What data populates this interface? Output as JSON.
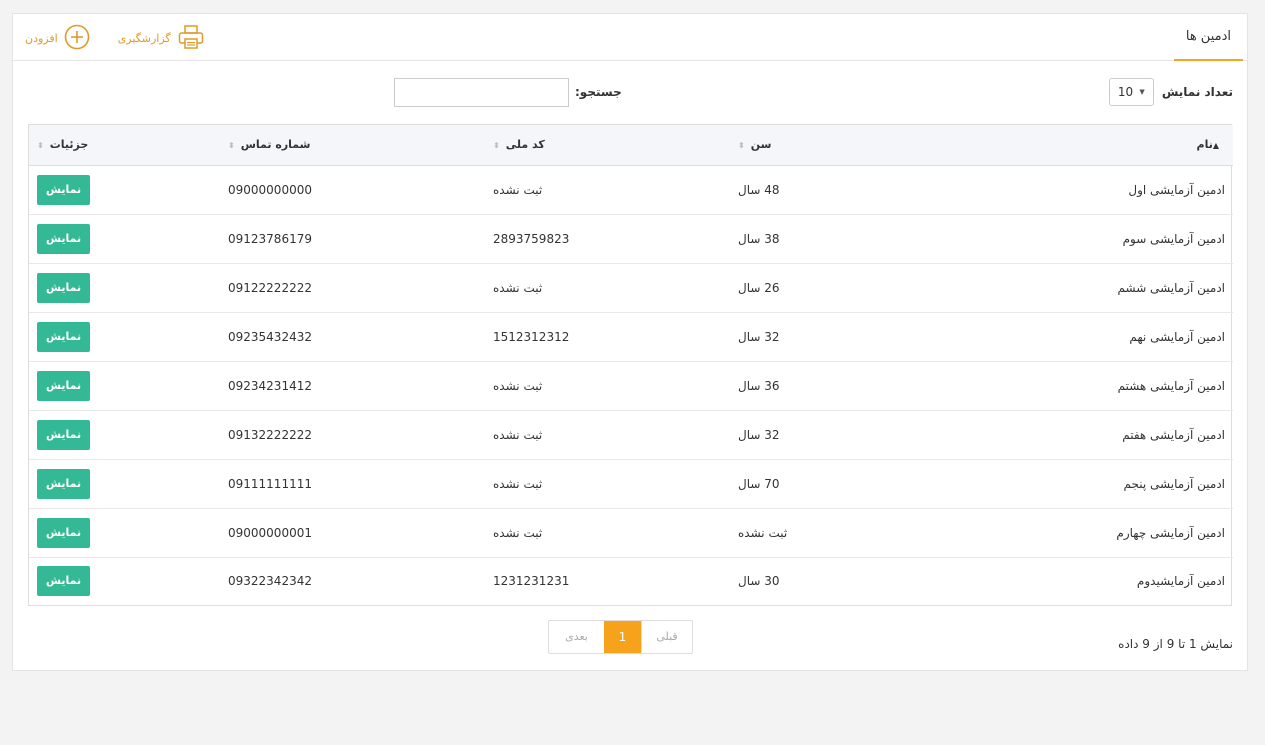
{
  "header": {
    "title": "ادمین ها",
    "add_label": "افزودن",
    "report_label": "گزارشگیری"
  },
  "controls": {
    "length_label": "تعداد نمایش",
    "length_value": "10",
    "search_label": "جستجو:",
    "search_value": ""
  },
  "table": {
    "columns": [
      "نام",
      "سن",
      "کد ملی",
      "شماره تماس",
      "جزئیات"
    ],
    "show_label": "نمایش",
    "rows": [
      {
        "name": "ادمین آزمایشی اول",
        "age": "48 سال",
        "national_code": "ثبت نشده",
        "phone": "09000000000"
      },
      {
        "name": "ادمین آزمایشی سوم",
        "age": "38 سال",
        "national_code": "2893759823",
        "phone": "09123786179"
      },
      {
        "name": "ادمین آزمایشی ششم",
        "age": "26 سال",
        "national_code": "ثبت نشده",
        "phone": "09122222222"
      },
      {
        "name": "ادمین آزمایشی نهم",
        "age": "32 سال",
        "national_code": "1512312312",
        "phone": "09235432432"
      },
      {
        "name": "ادمین آزمایشی هشتم",
        "age": "36 سال",
        "national_code": "ثبت نشده",
        "phone": "09234231412"
      },
      {
        "name": "ادمین آزمایشی هفتم",
        "age": "32 سال",
        "national_code": "ثبت نشده",
        "phone": "09132222222"
      },
      {
        "name": "ادمین آزمایشی پنجم",
        "age": "70 سال",
        "national_code": "ثبت نشده",
        "phone": "09111111111"
      },
      {
        "name": "ادمین آزمایشی چهارم",
        "age": "ثبت نشده",
        "national_code": "ثبت نشده",
        "phone": "09000000001"
      },
      {
        "name": "ادمین آزمایشیدوم",
        "age": "30 سال",
        "national_code": "1231231231",
        "phone": "09322342342"
      }
    ]
  },
  "footer": {
    "info": "نمایش 1 تا 9 از 9 داده",
    "prev_label": "قبلی",
    "current_page": "1",
    "next_label": "بعدی"
  },
  "colors": {
    "accent": "#f6a623",
    "show_button": "#33b995",
    "current_page": "#f7a21b"
  }
}
